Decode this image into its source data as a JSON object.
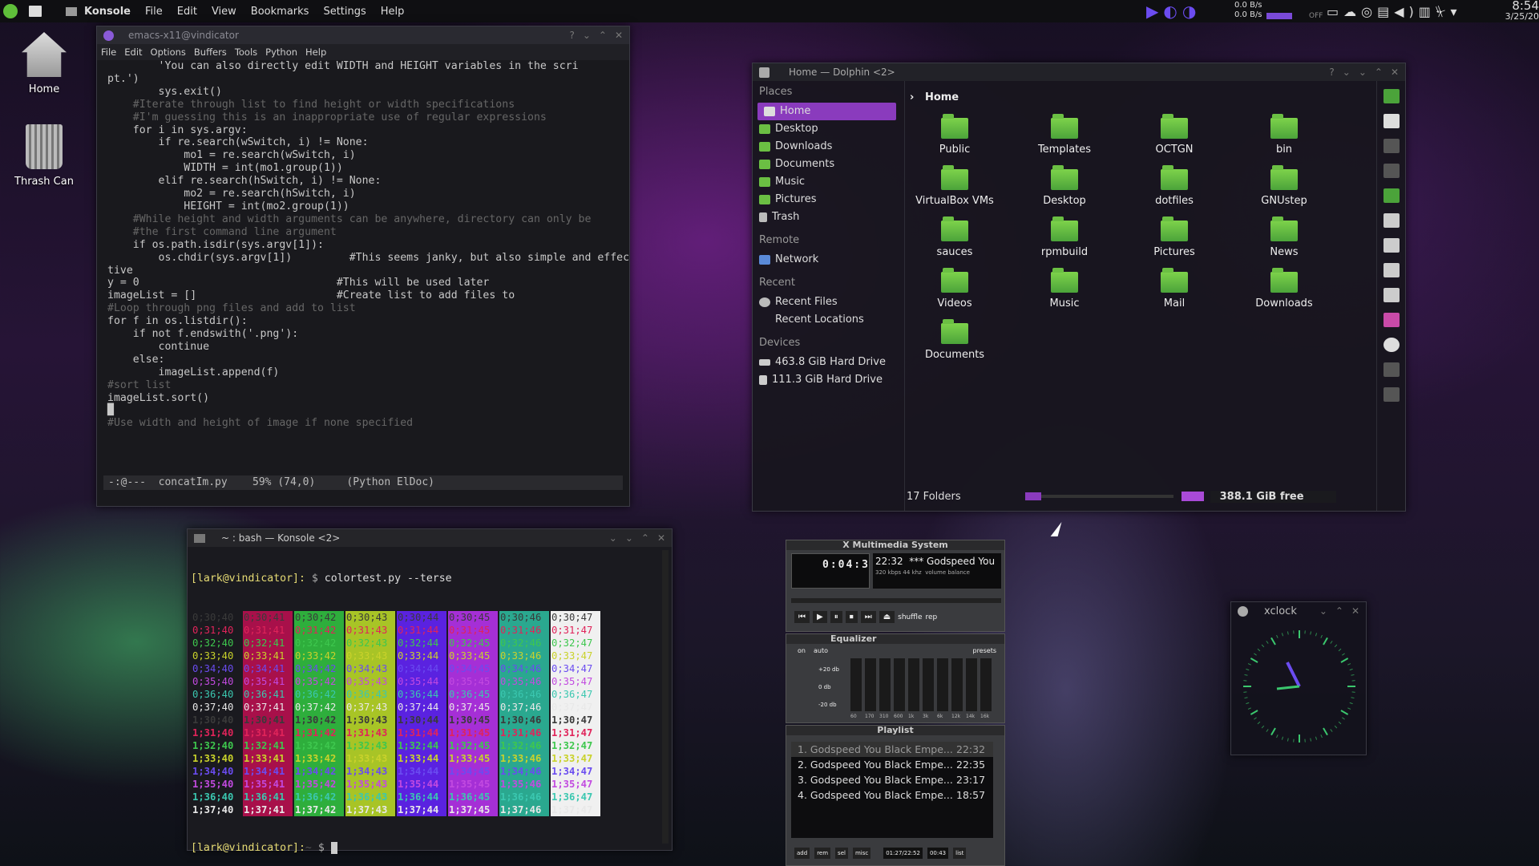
{
  "topbar": {
    "app": "Konsole",
    "menus": [
      "File",
      "Edit",
      "View",
      "Bookmarks",
      "Settings",
      "Help"
    ],
    "net_up": "0.0 B/s",
    "net_down": "0.0 B/s",
    "toggle": "OFF",
    "time": "8:54",
    "date": "3/25/20"
  },
  "desktop": {
    "icons": [
      "Home",
      "Thrash Can"
    ]
  },
  "emacs": {
    "title": "emacs-x11@vindicator",
    "menus": [
      "File",
      "Edit",
      "Options",
      "Buffers",
      "Tools",
      "Python",
      "Help"
    ],
    "code": [
      "        'You can also directly edit WIDTH and HEIGHT variables in the scri",
      "pt.')",
      "        sys.exit()",
      "    #Iterate through list to find height or width specifications",
      "    #I'm guessing this is an inappropriate use of regular expressions",
      "    for i in sys.argv:",
      "        if re.search(wSwitch, i) != None:",
      "            mo1 = re.search(wSwitch, i)",
      "            WIDTH = int(mo1.group(1))",
      "        elif re.search(hSwitch, i) != None:",
      "            mo2 = re.search(hSwitch, i)",
      "            HEIGHT = int(mo2.group(1))",
      "    #While height and width arguments can be anywhere, directory can only be",
      "    #the first command line argument",
      "    if os.path.isdir(sys.argv[1]):",
      "        os.chdir(sys.argv[1])         #This seems janky, but also simple and effec",
      "tive",
      "",
      "y = 0                               #This will be used later",
      "imageList = []                      #Create list to add files to",
      "",
      "#Loop through png files and add to list",
      "for f in os.listdir():",
      "    if not f.endswith('.png'):",
      "        continue",
      "    else:",
      "        imageList.append(f)",
      "",
      "#sort list",
      "imageList.sort()",
      "█",
      "#Use width and height of image if none specified"
    ],
    "modeline": "-:@---  concatIm.py    59% (74,0)     (Python ElDoc)"
  },
  "konsole": {
    "title": "~ : bash — Konsole <2>",
    "prompt": "[lark@vindicator]:",
    "path": "~",
    "command": "colortest.py --terse",
    "rows": [
      [
        "0;30;40",
        "0;30;41",
        "0;30;42",
        "0;30;43",
        "0;30;44",
        "0;30;45",
        "0;30;46",
        "0;30;47"
      ],
      [
        "0;31;40",
        "0;31;41",
        "0;31;42",
        "0;31;43",
        "0;31;44",
        "0;31;45",
        "0;31;46",
        "0;31;47"
      ],
      [
        "0;32;40",
        "0;32;41",
        "0;32;42",
        "0;32;43",
        "0;32;44",
        "0;32;45",
        "0;32;46",
        "0;32;47"
      ],
      [
        "0;33;40",
        "0;33;41",
        "0;33;42",
        "0;33;43",
        "0;33;44",
        "0;33;45",
        "0;33;46",
        "0;33;47"
      ],
      [
        "0;34;40",
        "0;34;41",
        "0;34;42",
        "0;34;43",
        "0;34;44",
        "0;34;45",
        "0;34;46",
        "0;34;47"
      ],
      [
        "0;35;40",
        "0;35;41",
        "0;35;42",
        "0;35;43",
        "0;35;44",
        "0;35;45",
        "0;35;46",
        "0;35;47"
      ],
      [
        "0;36;40",
        "0;36;41",
        "0;36;42",
        "0;36;43",
        "0;36;44",
        "0;36;45",
        "0;36;46",
        "0;36;47"
      ],
      [
        "0;37;40",
        "0;37;41",
        "0;37;42",
        "0;37;43",
        "0;37;44",
        "0;37;45",
        "0;37;46",
        "0;37;47"
      ],
      [
        "1;30;40",
        "1;30;41",
        "1;30;42",
        "1;30;43",
        "1;30;44",
        "1;30;45",
        "1;30;46",
        "1;30;47"
      ],
      [
        "1;31;40",
        "1;31;41",
        "1;31;42",
        "1;31;43",
        "1;31;44",
        "1;31;45",
        "1;31;46",
        "1;31;47"
      ],
      [
        "1;32;40",
        "1;32;41",
        "1;32;42",
        "1;32;43",
        "1;32;44",
        "1;32;45",
        "1;32;46",
        "1;32;47"
      ],
      [
        "1;33;40",
        "1;33;41",
        "1;33;42",
        "1;33;43",
        "1;33;44",
        "1;33;45",
        "1;33;46",
        "1;33;47"
      ],
      [
        "1;34;40",
        "1;34;41",
        "1;34;42",
        "1;34;43",
        "1;34;44",
        "1;34;45",
        "1;34;46",
        "1;34;47"
      ],
      [
        "1;35;40",
        "1;35;41",
        "1;35;42",
        "1;35;43",
        "1;35;44",
        "1;35;45",
        "1;35;46",
        "1;35;47"
      ],
      [
        "1;36;40",
        "1;36;41",
        "1;36;42",
        "1;36;43",
        "1;36;44",
        "1;36;45",
        "1;36;46",
        "1;36;47"
      ],
      [
        "1;37;40",
        "1;37;41",
        "1;37;42",
        "1;37;43",
        "1;37;44",
        "1;37;45",
        "1;37;46",
        "1;37;47"
      ]
    ],
    "fg": [
      "#3a3a3a",
      "#e0245a",
      "#3ec74e",
      "#c9d22b",
      "#6a4cf0",
      "#c24ae0",
      "#3bc7b0",
      "#e8e8e8"
    ],
    "bg": [
      "#151515",
      "#a8104a",
      "#2eae3c",
      "#a8c426",
      "#5a22e0",
      "#a52fd6",
      "#2aa88f",
      "#f0f0f0"
    ]
  },
  "dolphin": {
    "title": "Home — Dolphin <2>",
    "breadcrumb": "Home",
    "places_header": "Places",
    "places": [
      "Home",
      "Desktop",
      "Downloads",
      "Documents",
      "Music",
      "Pictures",
      "Trash"
    ],
    "remote_header": "Remote",
    "remote": [
      "Network"
    ],
    "recent_header": "Recent",
    "recent": [
      "Recent Files",
      "Recent Locations"
    ],
    "devices_header": "Devices",
    "devices": [
      "463.8 GiB Hard Drive",
      "111.3 GiB Hard Drive"
    ],
    "folders": [
      "Public",
      "Templates",
      "OCTGN",
      "bin",
      "VirtualBox VMs",
      "Desktop",
      "dotfiles",
      "GNUstep",
      "sauces",
      "rpmbuild",
      "Pictures",
      "News",
      "Videos",
      "Music",
      "Mail",
      "Downloads",
      "Documents"
    ],
    "status": "17 Folders",
    "free": "388.1 GiB free"
  },
  "xmms": {
    "title": "X Multimedia System",
    "time": "0:04:3",
    "track_len": "22:32",
    "track_title": "*** Godspeed You",
    "kbps": "320",
    "khz": "44",
    "shuffle": "shuffle",
    "rep": "rep",
    "eq_title": "Equalizer",
    "eq_on": "on",
    "eq_auto": "auto",
    "presets": "presets",
    "eq_labels": [
      "60",
      "170",
      "310",
      "600",
      "1k",
      "3k",
      "6k",
      "12k",
      "14k",
      "16k"
    ],
    "db_top": "+20 db",
    "db_mid": "0 db",
    "db_bot": "-20 db",
    "volume": "volume",
    "balance": "balance",
    "pl_title": "Playlist",
    "playlist": [
      [
        "1. Godspeed You Black Empe...",
        "22:32"
      ],
      [
        "2. Godspeed You Black Empe...",
        "22:35"
      ],
      [
        "3. Godspeed You Black Empe...",
        "23:17"
      ],
      [
        "4. Godspeed You Black Empe...",
        "18:57"
      ]
    ],
    "pl_buttons": [
      "add",
      "rem",
      "sel",
      "misc"
    ],
    "pl_time": "01:27/22:52",
    "pl_pos": "00:43",
    "pl_list": "list"
  },
  "xclock": {
    "title": "xclock"
  }
}
